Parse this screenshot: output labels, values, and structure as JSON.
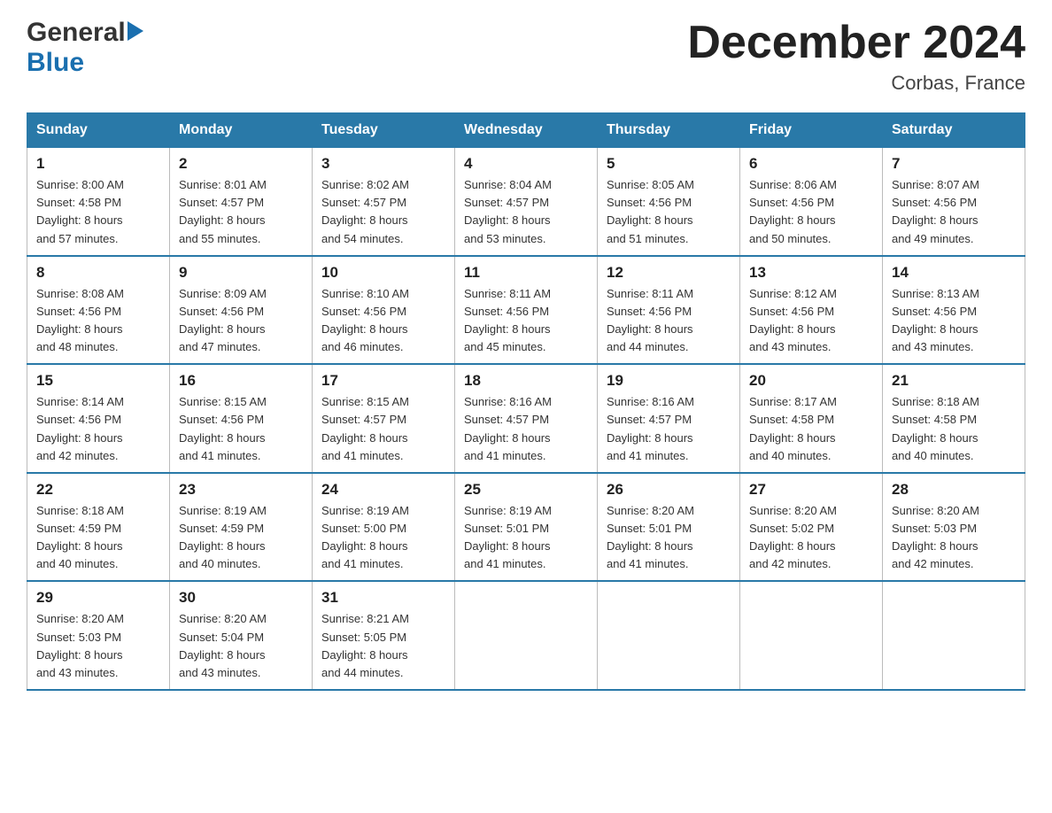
{
  "header": {
    "logo_line1": "General",
    "logo_arrow": "▶",
    "logo_line2": "Blue",
    "month_title": "December 2024",
    "location": "Corbas, France"
  },
  "days_of_week": [
    "Sunday",
    "Monday",
    "Tuesday",
    "Wednesday",
    "Thursday",
    "Friday",
    "Saturday"
  ],
  "weeks": [
    [
      {
        "day": "1",
        "sunrise": "8:00 AM",
        "sunset": "4:58 PM",
        "daylight": "8 hours and 57 minutes."
      },
      {
        "day": "2",
        "sunrise": "8:01 AM",
        "sunset": "4:57 PM",
        "daylight": "8 hours and 55 minutes."
      },
      {
        "day": "3",
        "sunrise": "8:02 AM",
        "sunset": "4:57 PM",
        "daylight": "8 hours and 54 minutes."
      },
      {
        "day": "4",
        "sunrise": "8:04 AM",
        "sunset": "4:57 PM",
        "daylight": "8 hours and 53 minutes."
      },
      {
        "day": "5",
        "sunrise": "8:05 AM",
        "sunset": "4:56 PM",
        "daylight": "8 hours and 51 minutes."
      },
      {
        "day": "6",
        "sunrise": "8:06 AM",
        "sunset": "4:56 PM",
        "daylight": "8 hours and 50 minutes."
      },
      {
        "day": "7",
        "sunrise": "8:07 AM",
        "sunset": "4:56 PM",
        "daylight": "8 hours and 49 minutes."
      }
    ],
    [
      {
        "day": "8",
        "sunrise": "8:08 AM",
        "sunset": "4:56 PM",
        "daylight": "8 hours and 48 minutes."
      },
      {
        "day": "9",
        "sunrise": "8:09 AM",
        "sunset": "4:56 PM",
        "daylight": "8 hours and 47 minutes."
      },
      {
        "day": "10",
        "sunrise": "8:10 AM",
        "sunset": "4:56 PM",
        "daylight": "8 hours and 46 minutes."
      },
      {
        "day": "11",
        "sunrise": "8:11 AM",
        "sunset": "4:56 PM",
        "daylight": "8 hours and 45 minutes."
      },
      {
        "day": "12",
        "sunrise": "8:11 AM",
        "sunset": "4:56 PM",
        "daylight": "8 hours and 44 minutes."
      },
      {
        "day": "13",
        "sunrise": "8:12 AM",
        "sunset": "4:56 PM",
        "daylight": "8 hours and 43 minutes."
      },
      {
        "day": "14",
        "sunrise": "8:13 AM",
        "sunset": "4:56 PM",
        "daylight": "8 hours and 43 minutes."
      }
    ],
    [
      {
        "day": "15",
        "sunrise": "8:14 AM",
        "sunset": "4:56 PM",
        "daylight": "8 hours and 42 minutes."
      },
      {
        "day": "16",
        "sunrise": "8:15 AM",
        "sunset": "4:56 PM",
        "daylight": "8 hours and 41 minutes."
      },
      {
        "day": "17",
        "sunrise": "8:15 AM",
        "sunset": "4:57 PM",
        "daylight": "8 hours and 41 minutes."
      },
      {
        "day": "18",
        "sunrise": "8:16 AM",
        "sunset": "4:57 PM",
        "daylight": "8 hours and 41 minutes."
      },
      {
        "day": "19",
        "sunrise": "8:16 AM",
        "sunset": "4:57 PM",
        "daylight": "8 hours and 41 minutes."
      },
      {
        "day": "20",
        "sunrise": "8:17 AM",
        "sunset": "4:58 PM",
        "daylight": "8 hours and 40 minutes."
      },
      {
        "day": "21",
        "sunrise": "8:18 AM",
        "sunset": "4:58 PM",
        "daylight": "8 hours and 40 minutes."
      }
    ],
    [
      {
        "day": "22",
        "sunrise": "8:18 AM",
        "sunset": "4:59 PM",
        "daylight": "8 hours and 40 minutes."
      },
      {
        "day": "23",
        "sunrise": "8:19 AM",
        "sunset": "4:59 PM",
        "daylight": "8 hours and 40 minutes."
      },
      {
        "day": "24",
        "sunrise": "8:19 AM",
        "sunset": "5:00 PM",
        "daylight": "8 hours and 41 minutes."
      },
      {
        "day": "25",
        "sunrise": "8:19 AM",
        "sunset": "5:01 PM",
        "daylight": "8 hours and 41 minutes."
      },
      {
        "day": "26",
        "sunrise": "8:20 AM",
        "sunset": "5:01 PM",
        "daylight": "8 hours and 41 minutes."
      },
      {
        "day": "27",
        "sunrise": "8:20 AM",
        "sunset": "5:02 PM",
        "daylight": "8 hours and 42 minutes."
      },
      {
        "day": "28",
        "sunrise": "8:20 AM",
        "sunset": "5:03 PM",
        "daylight": "8 hours and 42 minutes."
      }
    ],
    [
      {
        "day": "29",
        "sunrise": "8:20 AM",
        "sunset": "5:03 PM",
        "daylight": "8 hours and 43 minutes."
      },
      {
        "day": "30",
        "sunrise": "8:20 AM",
        "sunset": "5:04 PM",
        "daylight": "8 hours and 43 minutes."
      },
      {
        "day": "31",
        "sunrise": "8:21 AM",
        "sunset": "5:05 PM",
        "daylight": "8 hours and 44 minutes."
      },
      null,
      null,
      null,
      null
    ]
  ],
  "labels": {
    "sunrise": "Sunrise:",
    "sunset": "Sunset:",
    "daylight": "Daylight:"
  }
}
